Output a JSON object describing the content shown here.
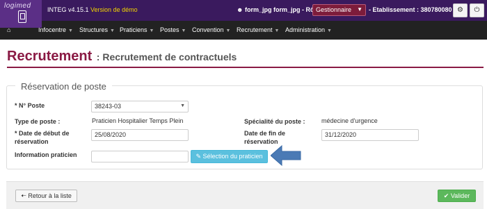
{
  "app": {
    "logo_text": "logimed",
    "name": "INTEG v4.15.1",
    "demo_label": "Version de démo",
    "user": "form_jpg form_jpg - Rôle :",
    "role_value": "Gestionnaire",
    "etablissement": "- Etablissement : 380780080"
  },
  "icons": {
    "user": "user-icon",
    "settings": "gear-icon",
    "power": "power-icon",
    "home": "home-icon",
    "pencil": "pencil-icon",
    "back": "arrow-left-icon",
    "check": "check-icon"
  },
  "nav": {
    "items": [
      {
        "label": "Infocentre"
      },
      {
        "label": "Structures"
      },
      {
        "label": "Praticiens"
      },
      {
        "label": "Postes"
      },
      {
        "label": "Convention"
      },
      {
        "label": "Recrutement"
      },
      {
        "label": "Administration"
      }
    ]
  },
  "page": {
    "title": "Recrutement",
    "subtitle": ": Recrutement de contractuels"
  },
  "form": {
    "legend": "Réservation de poste",
    "num_poste_label": "* N° Poste",
    "num_poste_value": "38243-03",
    "type_poste_label": "Type de poste :",
    "type_poste_value": "Praticien Hospitalier Temps Plein",
    "specialite_label": "Spécialité du poste :",
    "specialite_value": "médecine d'urgence",
    "date_debut_label": "* Date de début de réservation",
    "date_debut_value": "25/08/2020",
    "date_fin_label": "Date de fin de réservation",
    "date_fin_value": "31/12/2020",
    "info_praticien_label": "Information praticien",
    "info_praticien_value": "",
    "selection_button": "Sélection du praticien"
  },
  "footer": {
    "back_button": "Retour à la liste",
    "validate_button": "Valider"
  },
  "colors": {
    "topbar": "#3a1a5e",
    "accent": "#8a1a44",
    "info": "#5bc0de",
    "success": "#5cb85c",
    "arrow": "#4a7ab5"
  }
}
